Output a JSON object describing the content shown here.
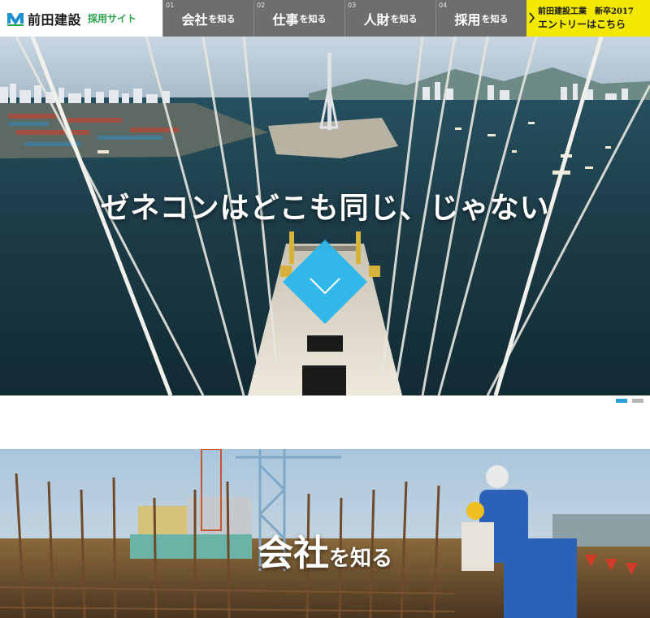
{
  "header": {
    "logo_text": "前田建設",
    "logo_sub": "採用サイト",
    "logo_icon": "maeda-logo-icon",
    "nav": [
      {
        "num": "01",
        "big": "会社",
        "small": "を知る"
      },
      {
        "num": "02",
        "big": "仕事",
        "small": "を知る"
      },
      {
        "num": "03",
        "big": "人財",
        "small": "を知る"
      },
      {
        "num": "04",
        "big": "採用",
        "small": "を知る"
      }
    ],
    "entry": {
      "line1": "前田建設工業　新卒2017",
      "line2": "エントリーはこちら"
    }
  },
  "hero": {
    "title": "ゼネコンはどこも同じ、じゃない",
    "scroll_icon": "chevron-down-icon",
    "slide_count": 2,
    "active_slide": 1
  },
  "section": {
    "title_big": "会社",
    "title_small": "を知る"
  },
  "colors": {
    "nav_bg": "#6e6e6e",
    "entry_bg": "#f2e800",
    "accent_blue": "#29b6ea",
    "logo_green": "#2aa34a",
    "dot_active": "#2a9fd8",
    "dot_inactive": "#b5b5b5"
  }
}
